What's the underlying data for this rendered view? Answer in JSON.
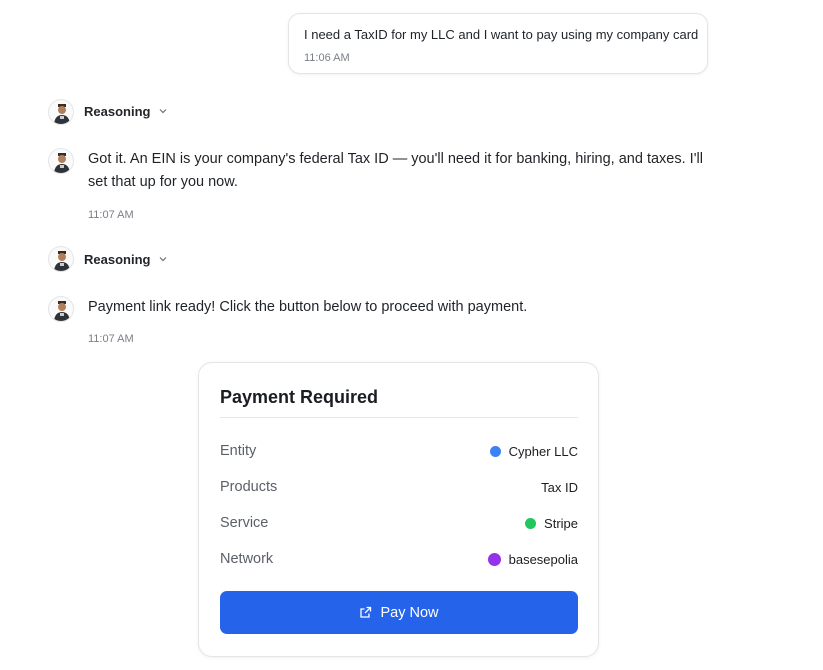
{
  "user_message": {
    "text": "I need a TaxID for my LLC and I want to pay using my company card",
    "time": "11:06 AM"
  },
  "reasoning_label": "Reasoning",
  "messages": [
    {
      "text_line1": "Got it. An EIN is your company's federal Tax ID — you'll need it for banking, hiring, and taxes. I'll",
      "text_line2": "set that up for you now.",
      "time": "11:07 AM"
    },
    {
      "text_line1": "Payment link ready! Click the button below to proceed with payment.",
      "time": "11:07 AM"
    }
  ],
  "payment_card": {
    "title": "Payment Required",
    "rows": [
      {
        "label": "Entity",
        "value": "Cypher LLC",
        "dot_color": "#3b82f6"
      },
      {
        "label": "Products",
        "value": "Tax ID"
      },
      {
        "label": "Service",
        "value": "Stripe",
        "dot_color": "#22c55e"
      },
      {
        "label": "Network",
        "value": "basesepolia",
        "dot_color": "#9333ea"
      }
    ],
    "button_label": "Pay Now",
    "button_color": "#2563eb"
  }
}
